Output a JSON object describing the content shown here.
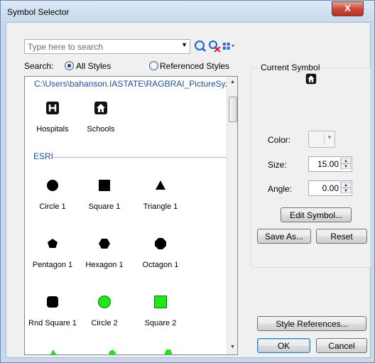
{
  "window": {
    "title": "Symbol Selector",
    "close_glyph": "X"
  },
  "search": {
    "placeholder": "Type here to search"
  },
  "search_scope": {
    "label": "Search:",
    "all_styles": "All Styles",
    "referenced_styles": "Referenced Styles",
    "selected": "All Styles"
  },
  "list": {
    "path": "C:\\Users\\bahanson.IASTATE\\RAGBRAI_PictureSy...",
    "custom_symbols": [
      {
        "label": "Hospitals",
        "icon": "hospital-icon"
      },
      {
        "label": "Schools",
        "icon": "school-icon"
      }
    ],
    "section": "ESRI",
    "esri_symbols": [
      {
        "label": "Circle 1",
        "icon": "black-circle-icon"
      },
      {
        "label": "Square 1",
        "icon": "black-square-icon"
      },
      {
        "label": "Triangle 1",
        "icon": "black-triangle-icon"
      },
      {
        "label": "Pentagon 1",
        "icon": "black-pentagon-icon"
      },
      {
        "label": "Hexagon 1",
        "icon": "black-hexagon-icon"
      },
      {
        "label": "Octagon 1",
        "icon": "black-octagon-icon"
      },
      {
        "label": "Rnd Square 1",
        "icon": "black-rounded-square-icon"
      },
      {
        "label": "Circle 2",
        "icon": "green-circle-icon"
      },
      {
        "label": "Square 2",
        "icon": "green-square-icon"
      }
    ]
  },
  "current_symbol": {
    "title": "Current Symbol",
    "preview_icon": "school-icon",
    "color_label": "Color:",
    "size_label": "Size:",
    "size_value": "15.00",
    "angle_label": "Angle:",
    "angle_value": "0.00"
  },
  "buttons": {
    "edit_symbol": "Edit Symbol...",
    "save_as": "Save As...",
    "reset": "Reset",
    "style_references": "Style References...",
    "ok": "OK",
    "cancel": "Cancel"
  },
  "colors": {
    "link_blue": "#1f4e9a",
    "green_symbol": "#22e61a"
  }
}
